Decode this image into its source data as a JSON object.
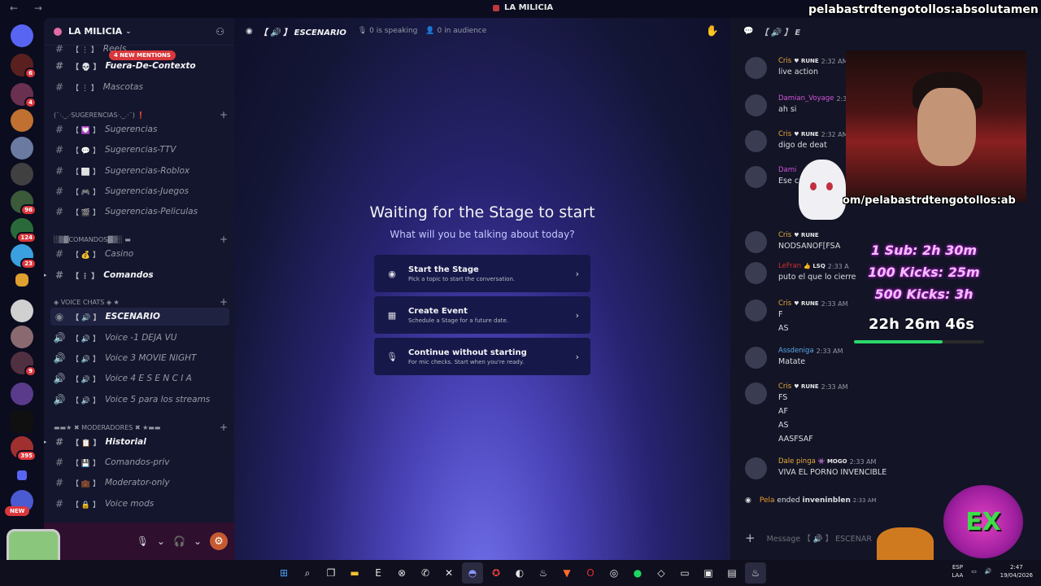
{
  "window": {
    "title": "LA MILICIA"
  },
  "servers": {
    "badges": [
      "6",
      "4",
      "96",
      "124",
      "23",
      "9",
      "395"
    ],
    "new_label": "NEW"
  },
  "sidebar": {
    "guild_name": "LA MILICIA",
    "mentions_pill": "4 NEW MENTIONS",
    "channels_top": [
      {
        "tag": "【 ⋮ 】",
        "name": "Reels"
      },
      {
        "tag": "【 💀 】",
        "name": "Fuera-De-Contexto"
      },
      {
        "tag": "【 ⋮ 】",
        "name": "Mascotas"
      }
    ],
    "cat_sugerencias": "(¨·._.·SUGERENCIAS·._.·¨) ❗",
    "sugerencias": [
      {
        "tag": "【 💟 】",
        "name": "Sugerencias"
      },
      {
        "tag": "【 💬 】",
        "name": "Sugerencias-TTV"
      },
      {
        "tag": "【 ⬜ 】",
        "name": "Sugerencias-Roblox"
      },
      {
        "tag": "【 🎮 】",
        "name": "Sugerencias-Juegos"
      },
      {
        "tag": "【 🎬 】",
        "name": "Sugerencias-Peliculas"
      }
    ],
    "cat_comandos": "░▒▓COMANDOS▓▒░ ▬",
    "comandos": [
      {
        "tag": "【 💰 】",
        "name": "Casino"
      },
      {
        "tag": "【 ⋮ 】",
        "name": "Comandos"
      }
    ],
    "cat_voice": "◈ VOICE CHATS ◈ ★",
    "voice": [
      {
        "tag": "【 🔊 】",
        "name": "ESCENARIO"
      },
      {
        "tag": "【 🔊 】",
        "name": "Voice -1 DEJA VU"
      },
      {
        "tag": "【 🔊 】",
        "name": "Voice 3 MOVIE NIGHT"
      },
      {
        "tag": "【 🔊 】",
        "name": "Voice 4 E S E N C I A"
      },
      {
        "tag": "【 🔊 】",
        "name": "Voice 5 para los streams"
      }
    ],
    "cat_mods": "▬▬★ ✖ MODERADORES ✖ ★▬▬",
    "mods": [
      {
        "tag": "【 📋 】",
        "name": "Historial"
      },
      {
        "tag": "【 💾 】",
        "name": "Comandos-priv"
      },
      {
        "tag": "【 💼 】",
        "name": "Moderator-only"
      },
      {
        "tag": "【 🔒 】",
        "name": "Voice mods"
      }
    ]
  },
  "stage": {
    "channel_title": "【 🔊 】 ESCENARIO",
    "speaking": "0 is speaking",
    "audience": "0 in audience",
    "heading": "Waiting for the Stage to start",
    "subheading": "What will you be talking about today?",
    "options": [
      {
        "title": "Start the Stage",
        "desc": "Pick a topic to start the conversation."
      },
      {
        "title": "Create Event",
        "desc": "Schedule a Stage for a future date."
      },
      {
        "title": "Continue without starting",
        "desc": "For mic checks. Start when you're ready."
      }
    ]
  },
  "chat": {
    "header": "【 🔊 】 E",
    "messages": [
      {
        "name": "Cris",
        "role": "♥ RUNE",
        "time": "2:32 AM",
        "lines": [
          "live action"
        ],
        "color": "#e6ad38"
      },
      {
        "name": "Damian_Voyage",
        "role": "",
        "time": "2:32 AM",
        "lines": [
          "ah si"
        ],
        "color": "#d154d6"
      },
      {
        "name": "Cris",
        "role": "♥ RUNE",
        "time": "2:32 AM",
        "lines": [
          "digo            de deat"
        ],
        "color": "#e6ad38"
      },
      {
        "name": "Dami",
        "role": "",
        "time": "",
        "lines": [
          "Ese c            egro"
        ],
        "color": "#d154d6"
      },
      {
        "name": "Cris",
        "role": "♥ RUNE",
        "time": "",
        "lines": [
          "NODSANOF[FSA"
        ],
        "color": "#e6ad38"
      },
      {
        "name": "LeFran",
        "role": "👍 LSQ",
        "time": "2:33 A",
        "lines": [
          "puto el que lo cierre"
        ],
        "color": "#d03030"
      },
      {
        "name": "Cris",
        "role": "♥ RUNE",
        "time": "2:33 AM",
        "lines": [
          "F",
          "AS"
        ],
        "color": "#e6ad38"
      },
      {
        "name": "Assdeniga",
        "role": "",
        "time": "2:33 AM",
        "lines": [
          "Matate"
        ],
        "color": "#5aa9e6"
      },
      {
        "name": "Cris",
        "role": "♥ RUNE",
        "time": "2:33 AM",
        "lines": [
          "FS",
          "AF",
          "AS",
          "AASFSAF"
        ],
        "color": "#e6ad38"
      },
      {
        "name": "Dale pinga",
        "role": "👾 MOGO",
        "time": "2:33 AM",
        "lines": [
          "VIVA EL PORNO INVENCIBLE"
        ],
        "color": "#e6ad38"
      }
    ],
    "system": {
      "name": "Pela",
      "text": "ended",
      "bold": "inveninblen",
      "time": "2:33 AM"
    },
    "input_placeholder": "Message 【 🔊 】 ESCENAR"
  },
  "overlay": {
    "name_top": "pelabastrdtengotollos:absolutamen",
    "name_mid": "om/pelabastrdtengotollos:ab",
    "sub_goals": [
      "1 Sub: 2h 30m",
      "100 Kicks: 25m",
      "500 Kicks: 3h"
    ],
    "timer": "22h 26m 46s",
    "timer_progress": 0.68,
    "logo_text": "EX"
  },
  "taskbar": {
    "lang": "ESP",
    "lang2": "LAA",
    "time": "2:47",
    "date": "19/04/2026"
  },
  "colors": {
    "accent": "#5865f2",
    "danger": "#da373c",
    "online": "#2bd96b"
  }
}
